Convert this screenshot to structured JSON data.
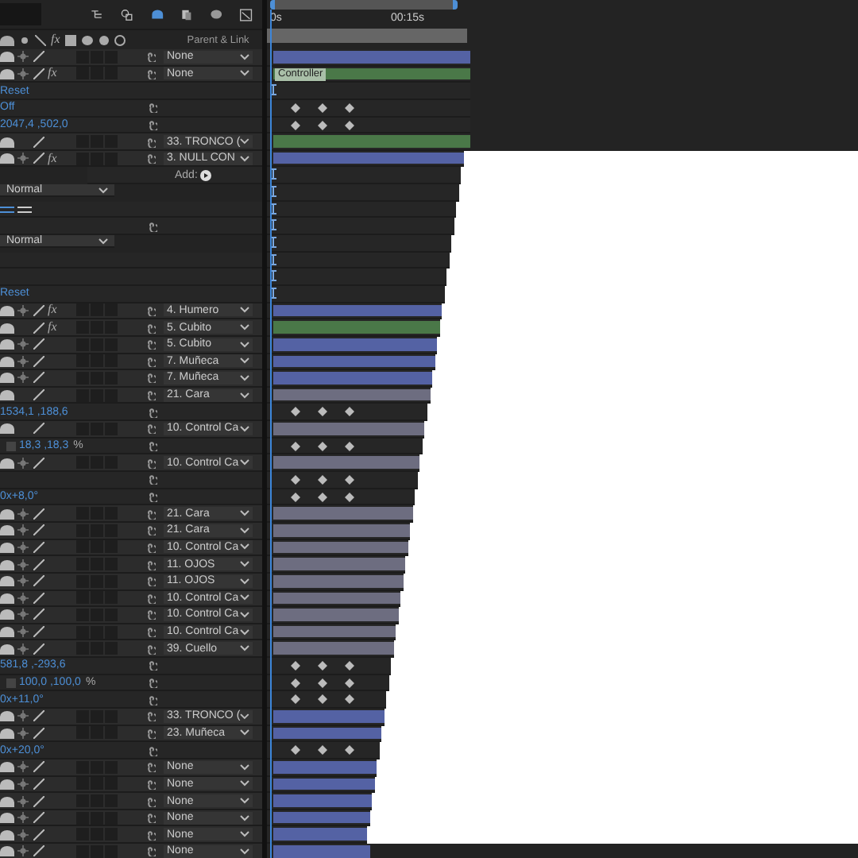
{
  "ruler": {
    "labels": [
      "0s",
      "00:15s"
    ]
  },
  "columns": {
    "fx": "fx",
    "parent_header": "Parent & Link"
  },
  "rows": [
    {
      "kind": "layer",
      "sun": true,
      "fx": "",
      "parent": "None",
      "track": {
        "kind": "bar",
        "color": "#5462a4"
      }
    },
    {
      "kind": "layer",
      "sun": true,
      "fx": "fx",
      "parent": "None",
      "track": {
        "kind": "bar",
        "color": "#4a7848",
        "label": "Controller"
      }
    },
    {
      "kind": "value",
      "value": "Reset",
      "pickwhip": false,
      "track": {
        "kind": "empty"
      }
    },
    {
      "kind": "value",
      "value": "Off",
      "pickwhip": true,
      "track": {
        "kind": "keys"
      }
    },
    {
      "kind": "value",
      "value": "2047,4 ,502,0",
      "pickwhip": true,
      "track": {
        "kind": "keys"
      }
    },
    {
      "kind": "layer",
      "sun": false,
      "fx": "",
      "parent": "33. TRONCO (",
      "track": {
        "kind": "bar",
        "color": "#4a7848"
      }
    },
    {
      "kind": "layer",
      "sun": true,
      "fx": "fx",
      "parent": "3. NULL CON",
      "track": {
        "kind": "bar",
        "color": "#5462a4"
      }
    },
    {
      "kind": "add",
      "label": "Add:",
      "track": {
        "kind": "empty"
      }
    },
    {
      "kind": "mode",
      "mode": "Normal",
      "track": {
        "kind": "empty"
      }
    },
    {
      "kind": "toggles",
      "track": {
        "kind": "empty"
      }
    },
    {
      "kind": "value",
      "value": "",
      "pickwhip": true,
      "track": {
        "kind": "empty"
      }
    },
    {
      "kind": "mode",
      "mode": "Normal",
      "track": {
        "kind": "empty"
      }
    },
    {
      "kind": "value",
      "value": "",
      "pickwhip": false,
      "track": {
        "kind": "empty"
      }
    },
    {
      "kind": "value",
      "value": "",
      "pickwhip": false,
      "track": {
        "kind": "empty"
      }
    },
    {
      "kind": "value",
      "value": "Reset",
      "pickwhip": false,
      "track": {
        "kind": "empty"
      }
    },
    {
      "kind": "layer",
      "sun": true,
      "fx": "fx",
      "parent": "4. Humero",
      "track": {
        "kind": "bar",
        "color": "#5462a4"
      }
    },
    {
      "kind": "layer",
      "sun": false,
      "fx": "fx",
      "parent": "5. Cubito",
      "track": {
        "kind": "bar",
        "color": "#4a7848"
      }
    },
    {
      "kind": "layer",
      "sun": true,
      "fx": "",
      "parent": "5. Cubito",
      "track": {
        "kind": "bar",
        "color": "#5462a4"
      }
    },
    {
      "kind": "layer",
      "sun": true,
      "fx": "",
      "parent": "7. Muñeca",
      "track": {
        "kind": "bar",
        "color": "#5462a4"
      }
    },
    {
      "kind": "layer",
      "sun": true,
      "fx": "",
      "parent": "7. Muñeca",
      "track": {
        "kind": "bar",
        "color": "#5462a4"
      }
    },
    {
      "kind": "layer",
      "sun": false,
      "fx": "",
      "parent": "21. Cara",
      "track": {
        "kind": "bar",
        "color": "#6d6d80"
      }
    },
    {
      "kind": "value",
      "value": "1534,1 ,188,6",
      "pickwhip": true,
      "track": {
        "kind": "keys"
      }
    },
    {
      "kind": "layer",
      "sun": false,
      "fx": "",
      "parent": "10. Control Ca",
      "track": {
        "kind": "bar",
        "color": "#6d6d80"
      }
    },
    {
      "kind": "value",
      "value": "18,3 ,18,3",
      "unit": "%",
      "pickwhip": true,
      "track": {
        "kind": "keys"
      }
    },
    {
      "kind": "layer",
      "sun": true,
      "fx": "",
      "parent": "10. Control Ca",
      "track": {
        "kind": "bar",
        "color": "#6d6d80"
      }
    },
    {
      "kind": "value",
      "value": "",
      "pickwhip": true,
      "track": {
        "kind": "keys"
      }
    },
    {
      "kind": "value",
      "value": "0x+8,0°",
      "pickwhip": true,
      "track": {
        "kind": "keys"
      }
    },
    {
      "kind": "layer",
      "sun": true,
      "fx": "",
      "parent": "21. Cara",
      "track": {
        "kind": "bar",
        "color": "#6d6d80"
      }
    },
    {
      "kind": "layer",
      "sun": true,
      "fx": "",
      "parent": "21. Cara",
      "track": {
        "kind": "bar",
        "color": "#6d6d80"
      }
    },
    {
      "kind": "layer",
      "sun": true,
      "fx": "",
      "parent": "10. Control Ca",
      "track": {
        "kind": "bar",
        "color": "#6d6d80"
      }
    },
    {
      "kind": "layer",
      "sun": true,
      "fx": "",
      "parent": "11. OJOS",
      "track": {
        "kind": "bar",
        "color": "#6d6d80"
      }
    },
    {
      "kind": "layer",
      "sun": true,
      "fx": "",
      "parent": "11. OJOS",
      "track": {
        "kind": "bar",
        "color": "#6d6d80"
      }
    },
    {
      "kind": "layer",
      "sun": true,
      "fx": "",
      "parent": "10. Control Ca",
      "track": {
        "kind": "bar",
        "color": "#6d6d80"
      }
    },
    {
      "kind": "layer",
      "sun": true,
      "fx": "",
      "parent": "10. Control Ca",
      "track": {
        "kind": "bar",
        "color": "#6d6d80"
      }
    },
    {
      "kind": "layer",
      "sun": true,
      "fx": "",
      "parent": "10. Control Ca",
      "track": {
        "kind": "bar",
        "color": "#6d6d80"
      }
    },
    {
      "kind": "layer",
      "sun": true,
      "fx": "",
      "parent": "39. Cuello",
      "track": {
        "kind": "bar",
        "color": "#6d6d80"
      }
    },
    {
      "kind": "value",
      "value": "581,8 ,-293,6",
      "pickwhip": true,
      "track": {
        "kind": "keys"
      }
    },
    {
      "kind": "value",
      "value": "100,0 ,100,0",
      "unit": "%",
      "pickwhip": true,
      "track": {
        "kind": "keys"
      }
    },
    {
      "kind": "value",
      "value": "0x+11,0°",
      "pickwhip": true,
      "track": {
        "kind": "keys"
      }
    },
    {
      "kind": "layer",
      "sun": true,
      "fx": "",
      "parent": "33. TRONCO (",
      "track": {
        "kind": "bar",
        "color": "#5462a4"
      }
    },
    {
      "kind": "layer",
      "sun": true,
      "fx": "",
      "parent": "23. Muñeca",
      "track": {
        "kind": "bar",
        "color": "#5462a4"
      }
    },
    {
      "kind": "value",
      "value": "0x+20,0°",
      "pickwhip": true,
      "track": {
        "kind": "keys"
      }
    },
    {
      "kind": "layer",
      "sun": true,
      "fx": "",
      "parent": "None",
      "track": {
        "kind": "bar",
        "color": "#5462a4"
      }
    },
    {
      "kind": "layer",
      "sun": true,
      "fx": "",
      "parent": "None",
      "track": {
        "kind": "bar",
        "color": "#5462a4"
      }
    },
    {
      "kind": "layer",
      "sun": true,
      "fx": "",
      "parent": "None",
      "track": {
        "kind": "bar",
        "color": "#5462a4"
      }
    },
    {
      "kind": "layer",
      "sun": true,
      "fx": "",
      "parent": "None",
      "track": {
        "kind": "bar",
        "color": "#5462a4"
      }
    },
    {
      "kind": "layer",
      "sun": true,
      "fx": "",
      "parent": "None",
      "track": {
        "kind": "bar",
        "color": "#5462a4"
      }
    },
    {
      "kind": "layer",
      "sun": true,
      "fx": "",
      "parent": "None",
      "track": {
        "kind": "bar",
        "color": "#5462a4"
      }
    }
  ]
}
